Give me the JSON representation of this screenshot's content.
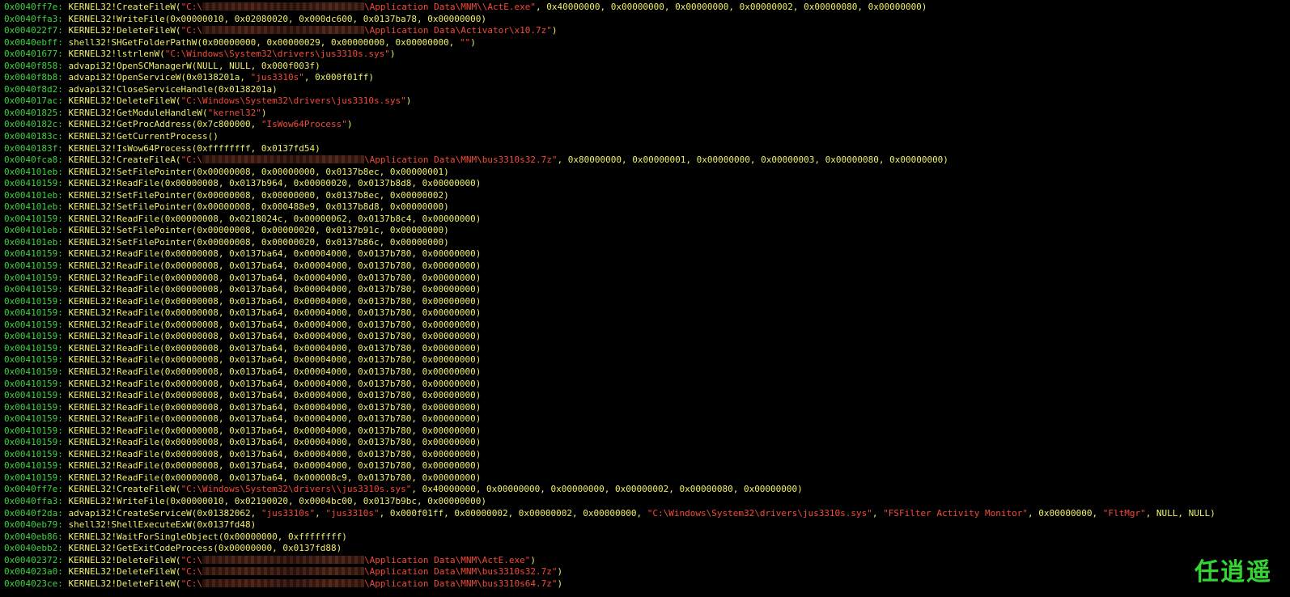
{
  "colors": {
    "background": "#000000",
    "address": "#3cd43c",
    "api": "#f0f068",
    "string": "#f24a3a",
    "watermark": "#34d434"
  },
  "lines": [
    [
      {
        "t": "addr",
        "v": "0x0040ff7e: "
      },
      {
        "t": "call",
        "v": "KERNEL32!CreateFileW("
      },
      {
        "t": "str",
        "v": "\"C:\\"
      },
      {
        "t": "redact"
      },
      {
        "t": "str",
        "v": "\\Application Data\\MNM\\\\ActE.exe\""
      },
      {
        "t": "call",
        "v": ", 0x40000000, 0x00000000, 0x00000000, 0x00000002, 0x00000080, 0x00000000)"
      }
    ],
    [
      {
        "t": "addr",
        "v": "0x0040ffa3: "
      },
      {
        "t": "call",
        "v": "KERNEL32!WriteFile(0x00000010, 0x02080020, 0x000dc600, 0x0137ba78, 0x00000000)"
      }
    ],
    [
      {
        "t": "addr",
        "v": "0x004022f7: "
      },
      {
        "t": "call",
        "v": "KERNEL32!DeleteFileW("
      },
      {
        "t": "str",
        "v": "\"C:\\"
      },
      {
        "t": "redact"
      },
      {
        "t": "str",
        "v": "\\Application Data\\Activator\\x10.7z\""
      },
      {
        "t": "call",
        "v": ")"
      }
    ],
    [
      {
        "t": "addr",
        "v": "0x0040ebff: "
      },
      {
        "t": "call",
        "v": "shell32!SHGetFolderPathW(0x00000000, 0x00000029, 0x00000000, 0x00000000, "
      },
      {
        "t": "str",
        "v": "\"\""
      },
      {
        "t": "call",
        "v": ")"
      }
    ],
    [
      {
        "t": "addr",
        "v": "0x00401677: "
      },
      {
        "t": "call",
        "v": "KERNEL32!lstrlenW("
      },
      {
        "t": "str",
        "v": "\"C:\\Windows\\System32\\drivers\\jus3310s.sys\""
      },
      {
        "t": "call",
        "v": ")"
      }
    ],
    [
      {
        "t": "addr",
        "v": "0x0040f858: "
      },
      {
        "t": "call",
        "v": "advapi32!OpenSCManagerW(NULL, NULL, 0x000f003f)"
      }
    ],
    [
      {
        "t": "addr",
        "v": "0x0040f8b8: "
      },
      {
        "t": "call",
        "v": "advapi32!OpenServiceW(0x0138201a, "
      },
      {
        "t": "str",
        "v": "\"jus3310s\""
      },
      {
        "t": "call",
        "v": ", 0x000f01ff)"
      }
    ],
    [
      {
        "t": "addr",
        "v": "0x0040f8d2: "
      },
      {
        "t": "call",
        "v": "advapi32!CloseServiceHandle(0x0138201a)"
      }
    ],
    [
      {
        "t": "addr",
        "v": "0x004017ac: "
      },
      {
        "t": "call",
        "v": "KERNEL32!DeleteFileW("
      },
      {
        "t": "str",
        "v": "\"C:\\Windows\\System32\\drivers\\jus3310s.sys\""
      },
      {
        "t": "call",
        "v": ")"
      }
    ],
    [
      {
        "t": "addr",
        "v": "0x00401825: "
      },
      {
        "t": "call",
        "v": "KERNEL32!GetModuleHandleW("
      },
      {
        "t": "str",
        "v": "\"kernel32\""
      },
      {
        "t": "call",
        "v": ")"
      }
    ],
    [
      {
        "t": "addr",
        "v": "0x0040182c: "
      },
      {
        "t": "call",
        "v": "KERNEL32!GetProcAddress(0x7c800000, "
      },
      {
        "t": "str",
        "v": "\"IsWow64Process\""
      },
      {
        "t": "call",
        "v": ")"
      }
    ],
    [
      {
        "t": "addr",
        "v": "0x0040183c: "
      },
      {
        "t": "call",
        "v": "KERNEL32!GetCurrentProcess()"
      }
    ],
    [
      {
        "t": "addr",
        "v": "0x0040183f: "
      },
      {
        "t": "call",
        "v": "KERNEL32!IsWow64Process(0xffffffff, 0x0137fd54)"
      }
    ],
    [
      {
        "t": "addr",
        "v": "0x0040fca8: "
      },
      {
        "t": "call",
        "v": "KERNEL32!CreateFileA("
      },
      {
        "t": "str",
        "v": "\"C:\\"
      },
      {
        "t": "redact"
      },
      {
        "t": "str",
        "v": "\\Application Data\\MNM\\bus3310s32.7z\""
      },
      {
        "t": "call",
        "v": ", 0x80000000, 0x00000001, 0x00000000, 0x00000003, 0x00000080, 0x00000000)"
      }
    ],
    [
      {
        "t": "addr",
        "v": "0x004101eb: "
      },
      {
        "t": "call",
        "v": "KERNEL32!SetFilePointer(0x00000008, 0x00000000, 0x0137b8ec, 0x00000001)"
      }
    ],
    [
      {
        "t": "addr",
        "v": "0x00410159: "
      },
      {
        "t": "call",
        "v": "KERNEL32!ReadFile(0x00000008, 0x0137b964, 0x00000020, 0x0137b8d8, 0x00000000)"
      }
    ],
    [
      {
        "t": "addr",
        "v": "0x004101eb: "
      },
      {
        "t": "call",
        "v": "KERNEL32!SetFilePointer(0x00000008, 0x00000000, 0x0137b8ec, 0x00000002)"
      }
    ],
    [
      {
        "t": "addr",
        "v": "0x004101eb: "
      },
      {
        "t": "call",
        "v": "KERNEL32!SetFilePointer(0x00000008, 0x000488e9, 0x0137b8d8, 0x00000000)"
      }
    ],
    [
      {
        "t": "addr",
        "v": "0x00410159: "
      },
      {
        "t": "call",
        "v": "KERNEL32!ReadFile(0x00000008, 0x0218024c, 0x00000062, 0x0137b8c4, 0x00000000)"
      }
    ],
    [
      {
        "t": "addr",
        "v": "0x004101eb: "
      },
      {
        "t": "call",
        "v": "KERNEL32!SetFilePointer(0x00000008, 0x00000020, 0x0137b91c, 0x00000000)"
      }
    ],
    [
      {
        "t": "addr",
        "v": "0x004101eb: "
      },
      {
        "t": "call",
        "v": "KERNEL32!SetFilePointer(0x00000008, 0x00000020, 0x0137b86c, 0x00000000)"
      }
    ],
    [
      {
        "t": "addr",
        "v": "0x00410159: "
      },
      {
        "t": "call",
        "v": "KERNEL32!ReadFile(0x00000008, 0x0137ba64, 0x00004000, 0x0137b780, 0x00000000)"
      }
    ],
    [
      {
        "t": "addr",
        "v": "0x00410159: "
      },
      {
        "t": "call",
        "v": "KERNEL32!ReadFile(0x00000008, 0x0137ba64, 0x00004000, 0x0137b780, 0x00000000)"
      }
    ],
    [
      {
        "t": "addr",
        "v": "0x00410159: "
      },
      {
        "t": "call",
        "v": "KERNEL32!ReadFile(0x00000008, 0x0137ba64, 0x00004000, 0x0137b780, 0x00000000)"
      }
    ],
    [
      {
        "t": "addr",
        "v": "0x00410159: "
      },
      {
        "t": "call",
        "v": "KERNEL32!ReadFile(0x00000008, 0x0137ba64, 0x00004000, 0x0137b780, 0x00000000)"
      }
    ],
    [
      {
        "t": "addr",
        "v": "0x00410159: "
      },
      {
        "t": "call",
        "v": "KERNEL32!ReadFile(0x00000008, 0x0137ba64, 0x00004000, 0x0137b780, 0x00000000)"
      }
    ],
    [
      {
        "t": "addr",
        "v": "0x00410159: "
      },
      {
        "t": "call",
        "v": "KERNEL32!ReadFile(0x00000008, 0x0137ba64, 0x00004000, 0x0137b780, 0x00000000)"
      }
    ],
    [
      {
        "t": "addr",
        "v": "0x00410159: "
      },
      {
        "t": "call",
        "v": "KERNEL32!ReadFile(0x00000008, 0x0137ba64, 0x00004000, 0x0137b780, 0x00000000)"
      }
    ],
    [
      {
        "t": "addr",
        "v": "0x00410159: "
      },
      {
        "t": "call",
        "v": "KERNEL32!ReadFile(0x00000008, 0x0137ba64, 0x00004000, 0x0137b780, 0x00000000)"
      }
    ],
    [
      {
        "t": "addr",
        "v": "0x00410159: "
      },
      {
        "t": "call",
        "v": "KERNEL32!ReadFile(0x00000008, 0x0137ba64, 0x00004000, 0x0137b780, 0x00000000)"
      }
    ],
    [
      {
        "t": "addr",
        "v": "0x00410159: "
      },
      {
        "t": "call",
        "v": "KERNEL32!ReadFile(0x00000008, 0x0137ba64, 0x00004000, 0x0137b780, 0x00000000)"
      }
    ],
    [
      {
        "t": "addr",
        "v": "0x00410159: "
      },
      {
        "t": "call",
        "v": "KERNEL32!ReadFile(0x00000008, 0x0137ba64, 0x00004000, 0x0137b780, 0x00000000)"
      }
    ],
    [
      {
        "t": "addr",
        "v": "0x00410159: "
      },
      {
        "t": "call",
        "v": "KERNEL32!ReadFile(0x00000008, 0x0137ba64, 0x00004000, 0x0137b780, 0x00000000)"
      }
    ],
    [
      {
        "t": "addr",
        "v": "0x00410159: "
      },
      {
        "t": "call",
        "v": "KERNEL32!ReadFile(0x00000008, 0x0137ba64, 0x00004000, 0x0137b780, 0x00000000)"
      }
    ],
    [
      {
        "t": "addr",
        "v": "0x00410159: "
      },
      {
        "t": "call",
        "v": "KERNEL32!ReadFile(0x00000008, 0x0137ba64, 0x00004000, 0x0137b780, 0x00000000)"
      }
    ],
    [
      {
        "t": "addr",
        "v": "0x00410159: "
      },
      {
        "t": "call",
        "v": "KERNEL32!ReadFile(0x00000008, 0x0137ba64, 0x00004000, 0x0137b780, 0x00000000)"
      }
    ],
    [
      {
        "t": "addr",
        "v": "0x00410159: "
      },
      {
        "t": "call",
        "v": "KERNEL32!ReadFile(0x00000008, 0x0137ba64, 0x00004000, 0x0137b780, 0x00000000)"
      }
    ],
    [
      {
        "t": "addr",
        "v": "0x00410159: "
      },
      {
        "t": "call",
        "v": "KERNEL32!ReadFile(0x00000008, 0x0137ba64, 0x00004000, 0x0137b780, 0x00000000)"
      }
    ],
    [
      {
        "t": "addr",
        "v": "0x00410159: "
      },
      {
        "t": "call",
        "v": "KERNEL32!ReadFile(0x00000008, 0x0137ba64, 0x00004000, 0x0137b780, 0x00000000)"
      }
    ],
    [
      {
        "t": "addr",
        "v": "0x00410159: "
      },
      {
        "t": "call",
        "v": "KERNEL32!ReadFile(0x00000008, 0x0137ba64, 0x00004000, 0x0137b780, 0x00000000)"
      }
    ],
    [
      {
        "t": "addr",
        "v": "0x00410159: "
      },
      {
        "t": "call",
        "v": "KERNEL32!ReadFile(0x00000008, 0x0137ba64, 0x000008c9, 0x0137b780, 0x00000000)"
      }
    ],
    [
      {
        "t": "addr",
        "v": "0x0040ff7e: "
      },
      {
        "t": "call",
        "v": "KERNEL32!CreateFileW("
      },
      {
        "t": "str",
        "v": "\"C:\\Windows\\System32\\drivers\\\\jus3310s.sys\""
      },
      {
        "t": "call",
        "v": ", 0x40000000, 0x00000000, 0x00000000, 0x00000002, 0x00000080, 0x00000000)"
      }
    ],
    [
      {
        "t": "addr",
        "v": "0x0040ffa3: "
      },
      {
        "t": "call",
        "v": "KERNEL32!WriteFile(0x00000010, 0x02190020, 0x0004bc00, 0x0137b9bc, 0x00000000)"
      }
    ],
    [
      {
        "t": "addr",
        "v": "0x0040f2da: "
      },
      {
        "t": "call",
        "v": "advapi32!CreateServiceW(0x01382062, "
      },
      {
        "t": "str",
        "v": "\"jus3310s\""
      },
      {
        "t": "call",
        "v": ", "
      },
      {
        "t": "str",
        "v": "\"jus3310s\""
      },
      {
        "t": "call",
        "v": ", 0x000f01ff, 0x00000002, 0x00000002, 0x00000000, "
      },
      {
        "t": "str",
        "v": "\"C:\\Windows\\System32\\drivers\\jus3310s.sys\""
      },
      {
        "t": "call",
        "v": ", "
      },
      {
        "t": "str",
        "v": "\"FSFilter Activity Monitor\""
      },
      {
        "t": "call",
        "v": ", 0x00000000, "
      },
      {
        "t": "str",
        "v": "\"FltMgr\""
      },
      {
        "t": "call",
        "v": ", NULL, NULL)"
      }
    ],
    [
      {
        "t": "addr",
        "v": "0x0040eb79: "
      },
      {
        "t": "call",
        "v": "shell32!ShellExecuteExW(0x0137fd48)"
      }
    ],
    [
      {
        "t": "addr",
        "v": "0x0040eb86: "
      },
      {
        "t": "call",
        "v": "KERNEL32!WaitForSingleObject(0x00000000, 0xffffffff)"
      }
    ],
    [
      {
        "t": "addr",
        "v": "0x0040ebb2: "
      },
      {
        "t": "call",
        "v": "KERNEL32!GetExitCodeProcess(0x00000000, 0x0137fd88)"
      }
    ],
    [
      {
        "t": "addr",
        "v": "0x00402372: "
      },
      {
        "t": "call",
        "v": "KERNEL32!DeleteFileW("
      },
      {
        "t": "str",
        "v": "\"C:\\"
      },
      {
        "t": "redact"
      },
      {
        "t": "str",
        "v": "\\Application Data\\MNM\\ActE.exe\""
      },
      {
        "t": "call",
        "v": ")"
      }
    ],
    [
      {
        "t": "addr",
        "v": "0x004023a0: "
      },
      {
        "t": "call",
        "v": "KERNEL32!DeleteFileW("
      },
      {
        "t": "str",
        "v": "\"C:\\"
      },
      {
        "t": "redact"
      },
      {
        "t": "str",
        "v": "\\Application Data\\MNM\\bus3310s32.7z\""
      },
      {
        "t": "call",
        "v": ")"
      }
    ],
    [
      {
        "t": "addr",
        "v": "0x004023ce: "
      },
      {
        "t": "call",
        "v": "KERNEL32!DeleteFileW("
      },
      {
        "t": "str",
        "v": "\"C:\\"
      },
      {
        "t": "redact"
      },
      {
        "t": "str",
        "v": "\\Application Data\\MNM\\bus3310s64.7z\""
      },
      {
        "t": "call",
        "v": ")"
      }
    ]
  ],
  "watermark": "任逍遥"
}
